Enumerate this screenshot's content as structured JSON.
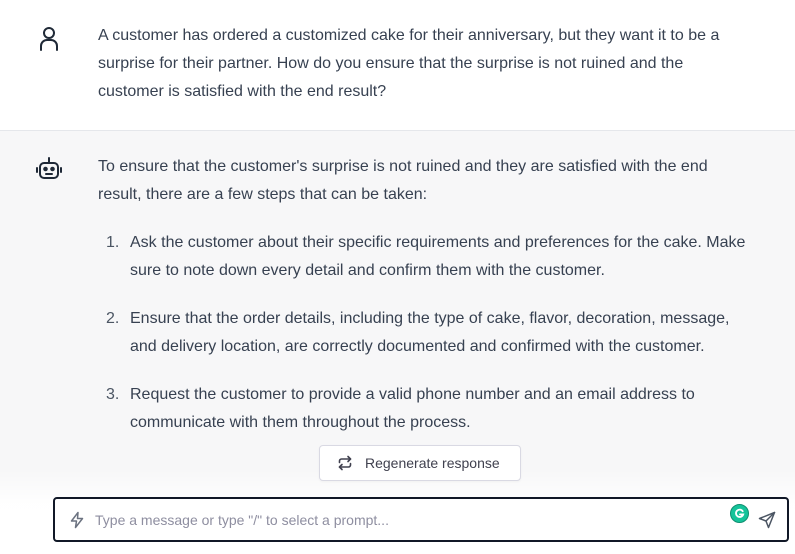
{
  "conversation": {
    "user_message": {
      "avatar_icon": "user-icon",
      "text": "A customer has ordered a customized cake for their anniversary, but they want it to be a surprise for their partner. How do you ensure that the surprise is not ruined and the customer is satisfied with the end result?"
    },
    "assistant_message": {
      "avatar_icon": "robot-icon",
      "intro": "To ensure that the customer's surprise is not ruined and they are satisfied with the end result, there are a few steps that can be taken:",
      "steps": [
        {
          "num": "1.",
          "text": "Ask the customer about their specific requirements and preferences for the cake. Make sure to note down every detail and confirm them with the customer."
        },
        {
          "num": "2.",
          "text": "Ensure that the order details, including the type of cake, flavor, decoration, message, and delivery location, are correctly documented and confirmed with the customer."
        },
        {
          "num": "3.",
          "text": "Request the customer to provide a valid phone number and an email address to communicate with them throughout the process."
        }
      ]
    }
  },
  "regenerate_button": {
    "label": "Regenerate response",
    "icon": "refresh-icon"
  },
  "composer": {
    "placeholder": "Type a message or type \"/\" to select a prompt...",
    "value": "",
    "prompt_icon": "bolt-icon",
    "grammarly_icon": "grammarly-icon",
    "send_icon": "send-icon"
  },
  "colors": {
    "assistant_bg": "#f7f7f8",
    "text": "#374151",
    "grammarly": "#15c39a"
  }
}
